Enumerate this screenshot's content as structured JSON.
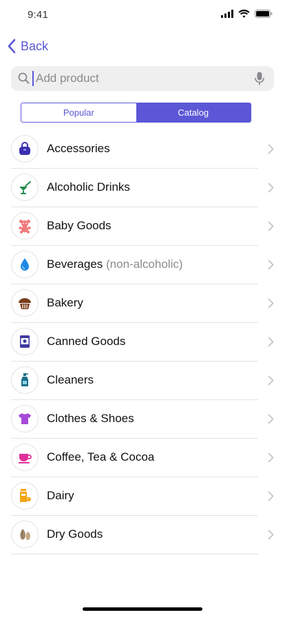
{
  "status": {
    "time": "9:41"
  },
  "nav": {
    "back_label": "Back"
  },
  "search": {
    "placeholder": "Add product",
    "value": ""
  },
  "tabs": [
    {
      "label": "Popular",
      "active": false
    },
    {
      "label": "Catalog",
      "active": true
    }
  ],
  "categories": [
    {
      "label": "Accessories",
      "sub": "",
      "icon": "handbag-icon",
      "color": "#3b2fb0"
    },
    {
      "label": "Alcoholic Drinks",
      "sub": "",
      "icon": "cocktail-icon",
      "color": "#1f8a4c"
    },
    {
      "label": "Baby Goods",
      "sub": "",
      "icon": "teddy-bear-icon",
      "color": "#f07a7a"
    },
    {
      "label": "Beverages",
      "sub": "(non-alcoholic)",
      "icon": "water-drop-icon",
      "color": "#1e88e5"
    },
    {
      "label": "Bakery",
      "sub": "",
      "icon": "muffin-icon",
      "color": "#7a3e1c"
    },
    {
      "label": "Canned Goods",
      "sub": "",
      "icon": "can-icon",
      "color": "#3f3aa0"
    },
    {
      "label": "Cleaners",
      "sub": "",
      "icon": "spray-bottle-icon",
      "color": "#1a6f86"
    },
    {
      "label": "Clothes & Shoes",
      "sub": "",
      "icon": "tshirt-icon",
      "color": "#a64ad9"
    },
    {
      "label": "Coffee, Tea & Cocoa",
      "sub": "",
      "icon": "cup-icon",
      "color": "#e0309a"
    },
    {
      "label": "Dairy",
      "sub": "",
      "icon": "milk-box-icon",
      "color": "#f2a516"
    },
    {
      "label": "Dry Goods",
      "sub": "",
      "icon": "seeds-icon",
      "color": "#a38a6a"
    }
  ]
}
